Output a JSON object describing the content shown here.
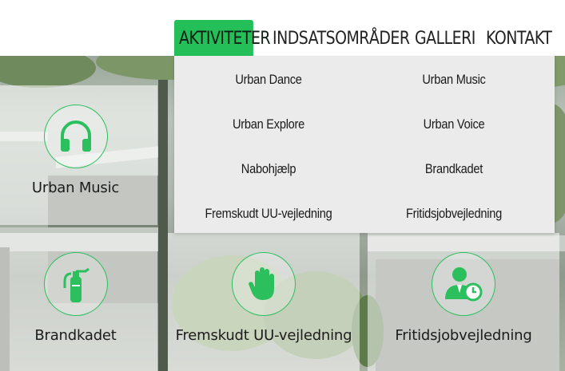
{
  "nav": {
    "items": [
      {
        "label": "AKTIVITETER"
      },
      {
        "label": "INDSATSOMRÅDER"
      },
      {
        "label": "GALLERI"
      },
      {
        "label": "KONTAKT"
      }
    ]
  },
  "dropdown": {
    "items": [
      {
        "label": "Urban Dance"
      },
      {
        "label": "Urban Music"
      },
      {
        "label": "Urban Explore"
      },
      {
        "label": "Urban Voice"
      },
      {
        "label": "Nabohjælp"
      },
      {
        "label": "Brandkadet"
      },
      {
        "label": "Fremskudt UU-vejledning"
      },
      {
        "label": "Fritidsjobvejledning"
      }
    ]
  },
  "tiles": [
    {
      "label": "Urban Music",
      "icon": "headphones-icon"
    },
    {
      "label": "Brandkadet",
      "icon": "fire-extinguisher-icon"
    },
    {
      "label": "Fremskudt UU-vejledning",
      "icon": "raised-hand-icon"
    },
    {
      "label": "Fritidsjobvejledning",
      "icon": "person-clock-icon"
    }
  ],
  "colors": {
    "accent": "#25bf5a",
    "icon": "#2bbf5e",
    "dropdown_bg": "#ebebeb"
  }
}
